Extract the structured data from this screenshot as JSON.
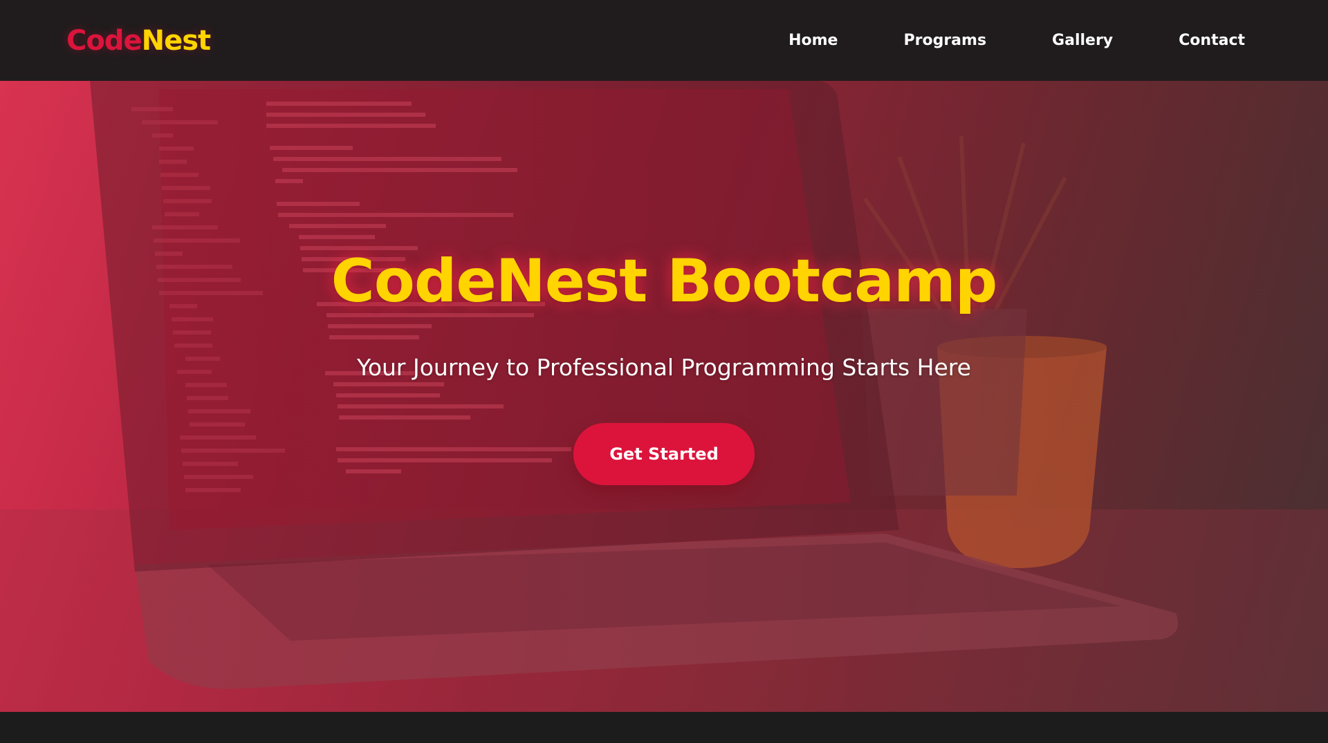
{
  "brand": {
    "logo_part1": "Code",
    "logo_part2": "Nest"
  },
  "nav": {
    "items": [
      {
        "label": "Home"
      },
      {
        "label": "Programs"
      },
      {
        "label": "Gallery"
      },
      {
        "label": "Contact"
      }
    ]
  },
  "hero": {
    "title": "CodeNest Bootcamp",
    "subtitle": "Your Journey to Professional Programming Starts Here",
    "cta_label": "Get Started"
  },
  "colors": {
    "accent": "#dc143c",
    "brand_yellow": "#ffd400",
    "header_bg": "#201c1d",
    "footer_bg": "#1c1c1c"
  },
  "background_icon": "laptop-code-photo"
}
